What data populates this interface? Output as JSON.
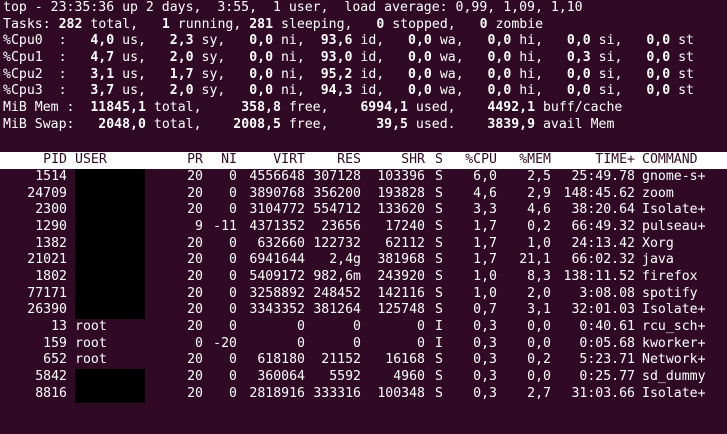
{
  "summary": {
    "line1": "top - 23:35:36 up 2 days,  3:55,  1 user,  load average: 0,99, 1,09, 1,10",
    "tasks": {
      "label": "Tasks:",
      "total": "282",
      "total_label": "total,",
      "running": "1",
      "running_label": "running,",
      "sleeping": "281",
      "sleeping_label": "sleeping,",
      "stopped": "0",
      "stopped_label": "stopped,",
      "zombie": "0",
      "zombie_label": "zombie"
    },
    "cpus": [
      {
        "label": "%Cpu0  :",
        "us": "4,0",
        "sy": "2,3",
        "ni": "0,0",
        "id": "93,6",
        "wa": "0,0",
        "hi": "0,0",
        "si": "0,0",
        "st": "0,0"
      },
      {
        "label": "%Cpu1  :",
        "us": "4,7",
        "sy": "2,0",
        "ni": "0,0",
        "id": "93,0",
        "wa": "0,0",
        "hi": "0,0",
        "si": "0,3",
        "st": "0,0"
      },
      {
        "label": "%Cpu2  :",
        "us": "3,1",
        "sy": "1,7",
        "ni": "0,0",
        "id": "95,2",
        "wa": "0,0",
        "hi": "0,0",
        "si": "0,0",
        "st": "0,0"
      },
      {
        "label": "%Cpu3  :",
        "us": "3,7",
        "sy": "2,0",
        "ni": "0,0",
        "id": "94,3",
        "wa": "0,0",
        "hi": "0,0",
        "si": "0,0",
        "st": "0,0"
      }
    ],
    "mem": {
      "label": "MiB Mem :",
      "total": "11845,1",
      "free": "358,8",
      "used": "6994,1",
      "buff": "4492,1",
      "buff_label": "buff/cache"
    },
    "swap": {
      "label": "MiB Swap:",
      "total": "2048,0",
      "free": "2008,5",
      "used": "39,5",
      "avail": "3839,9",
      "avail_label": "avail Mem"
    }
  },
  "table": {
    "headers": {
      "pid": "PID",
      "user": "USER",
      "pr": "PR",
      "ni": "NI",
      "virt": "VIRT",
      "res": "RES",
      "shr": "SHR",
      "s": "S",
      "cpu": "%CPU",
      "mem": "%MEM",
      "time": "TIME+",
      "command": "COMMAND"
    },
    "rows": [
      {
        "pid": "1514",
        "user": "",
        "redacted": true,
        "pr": "20",
        "ni": "0",
        "virt": "4556648",
        "res": "307128",
        "shr": "103396",
        "s": "S",
        "cpu": "6,0",
        "mem": "2,5",
        "time": "25:49.78",
        "command": "gnome-s+"
      },
      {
        "pid": "24709",
        "user": "",
        "redacted": true,
        "pr": "20",
        "ni": "0",
        "virt": "3890768",
        "res": "356200",
        "shr": "193828",
        "s": "S",
        "cpu": "4,6",
        "mem": "2,9",
        "time": "148:45.62",
        "command": "zoom"
      },
      {
        "pid": "2300",
        "user": "",
        "redacted": true,
        "pr": "20",
        "ni": "0",
        "virt": "3104772",
        "res": "554712",
        "shr": "133620",
        "s": "S",
        "cpu": "3,3",
        "mem": "4,6",
        "time": "38:20.64",
        "command": "Isolate+"
      },
      {
        "pid": "1290",
        "user": "",
        "redacted": true,
        "pr": "9",
        "ni": "-11",
        "virt": "4371352",
        "res": "23656",
        "shr": "17240",
        "s": "S",
        "cpu": "1,7",
        "mem": "0,2",
        "time": "66:49.32",
        "command": "pulseau+"
      },
      {
        "pid": "1382",
        "user": "",
        "redacted": true,
        "pr": "20",
        "ni": "0",
        "virt": "632660",
        "res": "122732",
        "shr": "62112",
        "s": "S",
        "cpu": "1,7",
        "mem": "1,0",
        "time": "24:13.42",
        "command": "Xorg"
      },
      {
        "pid": "21021",
        "user": "",
        "redacted": true,
        "pr": "20",
        "ni": "0",
        "virt": "6941644",
        "res": "2,4g",
        "shr": "381968",
        "s": "S",
        "cpu": "1,7",
        "mem": "21,1",
        "time": "66:02.32",
        "command": "java"
      },
      {
        "pid": "1802",
        "user": "",
        "redacted": true,
        "pr": "20",
        "ni": "0",
        "virt": "5409172",
        "res": "982,6m",
        "shr": "243920",
        "s": "S",
        "cpu": "1,0",
        "mem": "8,3",
        "time": "138:11.52",
        "command": "firefox"
      },
      {
        "pid": "77171",
        "user": "",
        "redacted": true,
        "pr": "20",
        "ni": "0",
        "virt": "3258892",
        "res": "248452",
        "shr": "142116",
        "s": "S",
        "cpu": "1,0",
        "mem": "2,0",
        "time": "3:08.08",
        "command": "spotify"
      },
      {
        "pid": "26390",
        "user": "",
        "redacted": true,
        "pr": "20",
        "ni": "0",
        "virt": "3343352",
        "res": "381264",
        "shr": "125748",
        "s": "S",
        "cpu": "0,7",
        "mem": "3,1",
        "time": "32:01.03",
        "command": "Isolate+"
      },
      {
        "pid": "13",
        "user": "root",
        "redacted": false,
        "pr": "20",
        "ni": "0",
        "virt": "0",
        "res": "0",
        "shr": "0",
        "s": "I",
        "cpu": "0,3",
        "mem": "0,0",
        "time": "0:40.61",
        "command": "rcu_sch+"
      },
      {
        "pid": "159",
        "user": "root",
        "redacted": false,
        "pr": "0",
        "ni": "-20",
        "virt": "0",
        "res": "0",
        "shr": "0",
        "s": "I",
        "cpu": "0,3",
        "mem": "0,0",
        "time": "0:05.68",
        "command": "kworker+"
      },
      {
        "pid": "652",
        "user": "root",
        "redacted": false,
        "pr": "20",
        "ni": "0",
        "virt": "618180",
        "res": "21152",
        "shr": "16168",
        "s": "S",
        "cpu": "0,3",
        "mem": "0,2",
        "time": "5:23.71",
        "command": "Network+"
      },
      {
        "pid": "5842",
        "user": "",
        "redacted": true,
        "pr": "20",
        "ni": "0",
        "virt": "360064",
        "res": "5592",
        "shr": "4960",
        "s": "S",
        "cpu": "0,3",
        "mem": "0,0",
        "time": "0:25.77",
        "command": "sd_dummy"
      },
      {
        "pid": "8816",
        "user": "",
        "redacted": true,
        "pr": "20",
        "ni": "0",
        "virt": "2818916",
        "res": "333316",
        "shr": "100348",
        "s": "S",
        "cpu": "0,3",
        "mem": "2,7",
        "time": "31:03.66",
        "command": "Isolate+"
      }
    ]
  }
}
